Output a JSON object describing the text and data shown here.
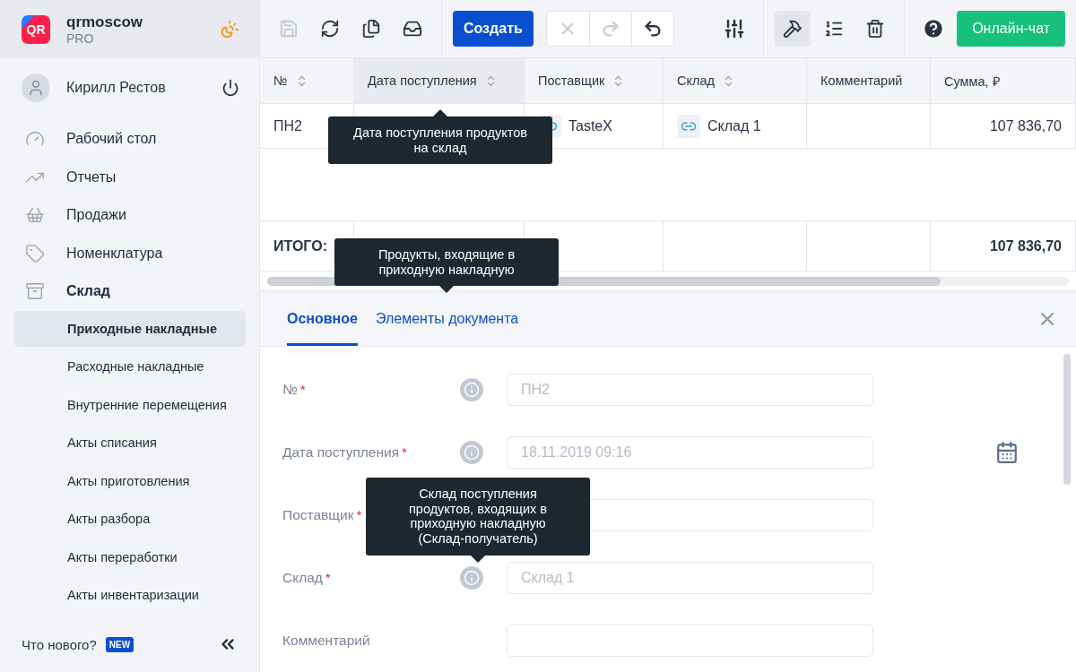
{
  "brand": {
    "logo_text": "QR",
    "name": "qrmoscow",
    "plan": "PRO"
  },
  "user": {
    "name": "Кирилл Рестов"
  },
  "nav": [
    {
      "label": "Рабочий стол",
      "expanded": false
    },
    {
      "label": "Отчеты",
      "expanded": false
    },
    {
      "label": "Продажи",
      "expanded": false
    },
    {
      "label": "Номенклатура",
      "expanded": false
    },
    {
      "label": "Склад",
      "expanded": true,
      "children": [
        {
          "label": "Приходные накладные",
          "selected": true
        },
        {
          "label": "Расходные накладные",
          "selected": false
        },
        {
          "label": "Внутренние перемещения",
          "selected": false
        },
        {
          "label": "Акты списания",
          "selected": false
        },
        {
          "label": "Акты приготовления",
          "selected": false
        },
        {
          "label": "Акты разбора",
          "selected": false
        },
        {
          "label": "Акты переработки",
          "selected": false
        },
        {
          "label": "Акты инвентаризации",
          "selected": false
        }
      ]
    }
  ],
  "whats_new": {
    "label": "Что нового?",
    "badge": "NEW"
  },
  "toolbar": {
    "file_actions": [
      {
        "disabled": true
      },
      {
        "disabled": false
      },
      {
        "disabled": false
      },
      {
        "disabled": false
      }
    ],
    "create_button": "Создать",
    "history_actions": [
      {
        "disabled": true
      },
      {
        "disabled": true
      },
      {
        "disabled": false
      }
    ],
    "view_actions": [
      {
        "pressed": false
      },
      {
        "pressed": true
      },
      {
        "pressed": false
      },
      {
        "pressed": false
      }
    ],
    "chat_button": "Онлайн-чат"
  },
  "table": {
    "columns": [
      {
        "label": "№",
        "sortable": true,
        "hovered": false
      },
      {
        "label": "Дата поступления",
        "sortable": true,
        "hovered": true
      },
      {
        "label": "Поставщик",
        "sortable": true,
        "hovered": false
      },
      {
        "label": "Склад",
        "sortable": true,
        "hovered": false
      },
      {
        "label": "Комментарий",
        "sortable": false,
        "hovered": false
      },
      {
        "label": "Сумма, ₽",
        "sortable": false,
        "hovered": false
      }
    ],
    "rows": [
      {
        "number": "ПН2",
        "supplier": "TasteX",
        "warehouse": "Склад 1",
        "amount": "107 836,70"
      }
    ],
    "total": {
      "label": "ИТОГО:",
      "amount": "107 836,70"
    }
  },
  "tooltips": [
    "Дата поступления продуктов на склад",
    "Продукты, входящие в приходную накладную",
    "Склад поступления продуктов, входящих в приходную накладную (Склад-получатель)"
  ],
  "tabs": [
    {
      "label": "Основное",
      "selected": true
    },
    {
      "label": "Элементы документа",
      "selected": false
    }
  ],
  "required_mark": "*",
  "form": [
    {
      "label": "№",
      "required": true,
      "info": true,
      "value": "ПН2",
      "calendar": false
    },
    {
      "label": "Дата поступления",
      "required": true,
      "info": true,
      "value": "18.11.2019 09:16",
      "calendar": true
    },
    {
      "label": "Поставщик",
      "required": true,
      "info": false,
      "calendar": false
    },
    {
      "label": "Склад",
      "required": true,
      "info": true,
      "value": "Склад 1",
      "calendar": false
    },
    {
      "label": "Комментарий",
      "required": false,
      "info": false,
      "calendar": false
    }
  ]
}
